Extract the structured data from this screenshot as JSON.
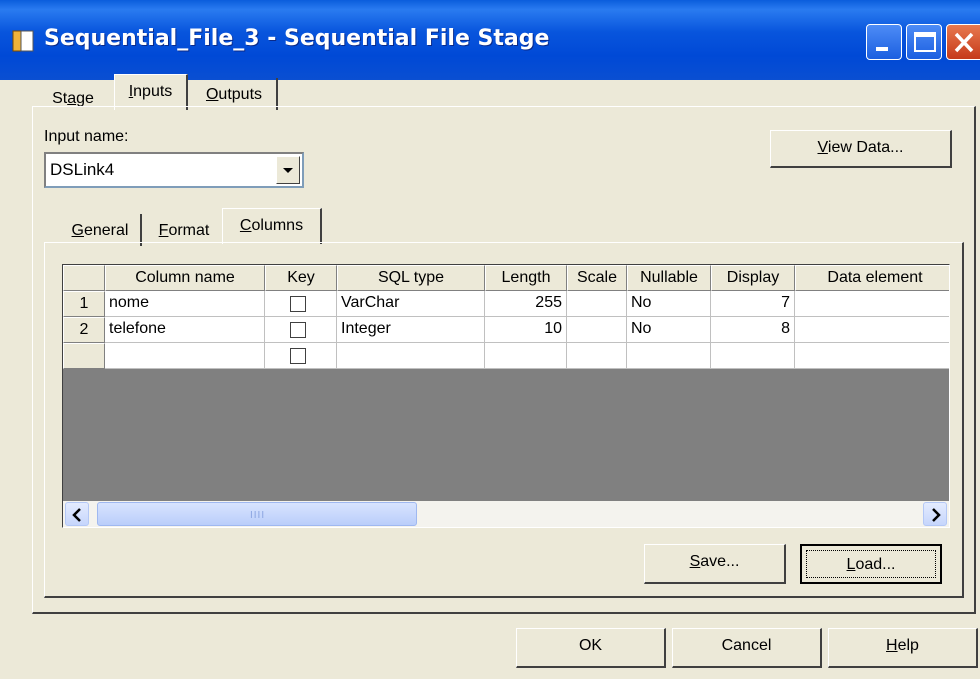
{
  "window": {
    "title": "Sequential_File_3 - Sequential File Stage",
    "controls": {
      "minimize": "minimize-icon",
      "maximize": "maximize-icon",
      "close": "close-icon"
    }
  },
  "tabs": [
    {
      "label": "Stage",
      "mnemonic": "a"
    },
    {
      "label": "Inputs",
      "mnemonic": "I"
    },
    {
      "label": "Outputs",
      "mnemonic": "O"
    }
  ],
  "active_tab": "Inputs",
  "input": {
    "label": "Input name:",
    "selected": "DSLink4"
  },
  "buttons": {
    "view_data": "View Data...",
    "save": "Save...",
    "load": "Load...",
    "ok": "OK",
    "cancel": "Cancel",
    "help": "Help"
  },
  "subtabs": [
    {
      "label": "General"
    },
    {
      "label": "Format"
    },
    {
      "label": "Columns"
    }
  ],
  "active_subtab": "Columns",
  "grid": {
    "columns": [
      "Column name",
      "Key",
      "SQL type",
      "Length",
      "Scale",
      "Nullable",
      "Display",
      "Data element"
    ],
    "rows": [
      {
        "num": "1",
        "name": "nome",
        "key": false,
        "sql_type": "VarChar",
        "length": "255",
        "scale": "",
        "nullable": "No",
        "display": "7",
        "data_element": ""
      },
      {
        "num": "2",
        "name": "telefone",
        "key": false,
        "sql_type": "Integer",
        "length": "10",
        "scale": "",
        "nullable": "No",
        "display": "8",
        "data_element": ""
      }
    ],
    "scrollbar_grip": "IIII"
  }
}
